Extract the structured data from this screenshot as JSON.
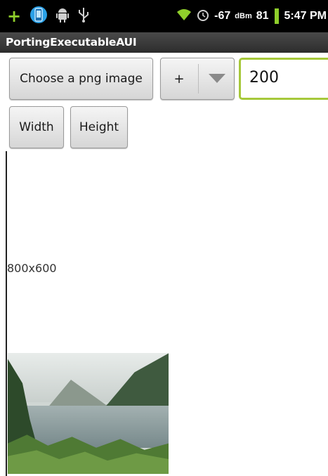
{
  "status_bar": {
    "signal_value": "-67",
    "signal_unit": "dBm",
    "battery": "81",
    "time": "5:47 PM",
    "icons": [
      "plus-icon",
      "phone-icon",
      "android-icon",
      "usb-icon",
      "wifi-icon",
      "alarm-icon",
      "battery-icon"
    ]
  },
  "title_bar": {
    "title": "PortingExecutableAUI"
  },
  "controls": {
    "choose_label": "Choose a png image",
    "spinner_value": "+",
    "number_value": "200",
    "width_label": "Width",
    "height_label": "Height"
  },
  "content": {
    "dimensions_text": "800x600"
  },
  "colors": {
    "accent": "#a6c83a",
    "status_green": "#8fce2b"
  }
}
